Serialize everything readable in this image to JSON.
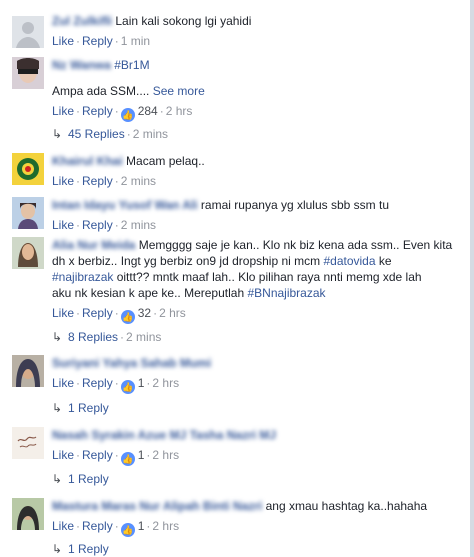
{
  "common": {
    "like": "Like",
    "reply": "Reply",
    "see_more": "See more"
  },
  "comments": [
    {
      "name": "Zul Zulkifli",
      "text": "Lain kali sokong lgi yahidi",
      "time": "1 min"
    },
    {
      "name": "Nz Wanwa",
      "tag": "#Br1M",
      "text": "Ampa ada SSM....",
      "reactions": "284",
      "time": "2 hrs",
      "replies": "45 Replies",
      "replies_time": "2 mins"
    },
    {
      "name": "Khairul Khai",
      "text": "Macam pelaq..",
      "time": "2 mins"
    },
    {
      "name": "Intan Idayu Yusof Wan Ali",
      "text": "ramai rupanya yg xlulus sbb ssm tu",
      "time": "2 mins"
    },
    {
      "name": "Alia Nur Meida",
      "text1": "Memgggg saje je kan.. Klo nk biz kena ada ssm.. Even kita",
      "text2": "dh x berbiz.. Ingt yg berbiz on9 jd dropship ni mcm",
      "tag2": "#datovida",
      "text2b": "ke",
      "tag3": "#najibrazak",
      "text3": "oittt?? mntk maaf lah.. Klo pilihan raya nnti memg xde lah",
      "text4": "aku nk kesian k ape ke.. Mereputlah",
      "tag4": "#BNnajibrazak",
      "reactions": "32",
      "time": "2 hrs",
      "replies": "8 Replies",
      "replies_time": "2 mins"
    },
    {
      "name": "Suriyani Yahya Sahab Mumi",
      "reactions": "1",
      "time": "2 hrs",
      "replies": "1 Reply"
    },
    {
      "name": "Nasah Syrakin Azue MJ Tasha Nazri MJ",
      "reactions": "1",
      "time": "2 hrs",
      "replies": "1 Reply"
    },
    {
      "name": "Mastura Maras Nur Alipah Binti Nazri",
      "text": "ang xmau hashtag ka..hahaha",
      "reactions": "1",
      "time": "2 hrs",
      "replies": "1 Reply"
    }
  ],
  "colors": {
    "link": "#365899",
    "meta": "#90949c",
    "reaction": "#5890ff"
  }
}
